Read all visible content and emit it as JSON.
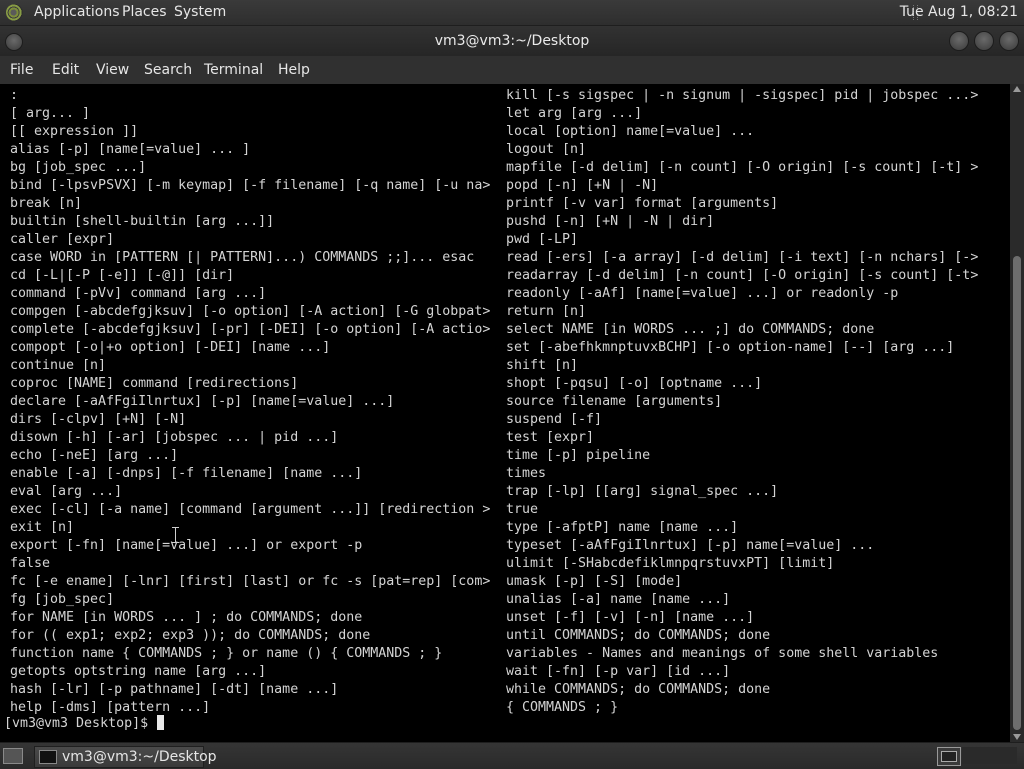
{
  "top_panel": {
    "menus": [
      "Applications",
      "Places",
      "System"
    ],
    "clock": "Tue Aug  1, 08:21"
  },
  "window": {
    "title": "vm3@vm3:~/Desktop",
    "menubar": [
      "File",
      "Edit",
      "View",
      "Search",
      "Terminal",
      "Help"
    ]
  },
  "terminal": {
    "left_column": [
      ":",
      "[ arg... ]",
      "[[ expression ]]",
      "alias [-p] [name[=value] ... ]",
      "bg [job_spec ...]",
      "bind [-lpsvPSVX] [-m keymap] [-f filename] [-q name] [-u na>",
      "break [n]",
      "builtin [shell-builtin [arg ...]]",
      "caller [expr]",
      "case WORD in [PATTERN [| PATTERN]...) COMMANDS ;;]... esac",
      "cd [-L|[-P [-e]] [-@]] [dir]",
      "command [-pVv] command [arg ...]",
      "compgen [-abcdefgjksuv] [-o option] [-A action] [-G globpat>",
      "complete [-abcdefgjksuv] [-pr] [-DEI] [-o option] [-A actio>",
      "compopt [-o|+o option] [-DEI] [name ...]",
      "continue [n]",
      "coproc [NAME] command [redirections]",
      "declare [-aAfFgiIlnrtux] [-p] [name[=value] ...]",
      "dirs [-clpv] [+N] [-N]",
      "disown [-h] [-ar] [jobspec ... | pid ...]",
      "echo [-neE] [arg ...]",
      "enable [-a] [-dnps] [-f filename] [name ...]",
      "eval [arg ...]",
      "exec [-cl] [-a name] [command [argument ...]] [redirection >",
      "exit [n]",
      "export [-fn] [name[=value] ...] or export -p",
      "false",
      "fc [-e ename] [-lnr] [first] [last] or fc -s [pat=rep] [com>",
      "fg [job_spec]",
      "for NAME [in WORDS ... ] ; do COMMANDS; done",
      "for (( exp1; exp2; exp3 )); do COMMANDS; done",
      "function name { COMMANDS ; } or name () { COMMANDS ; }",
      "getopts optstring name [arg ...]",
      "hash [-lr] [-p pathname] [-dt] [name ...]",
      "help [-dms] [pattern ...]"
    ],
    "right_column": [
      "kill [-s sigspec | -n signum | -sigspec] pid | jobspec ...>",
      "let arg [arg ...]",
      "local [option] name[=value] ...",
      "logout [n]",
      "mapfile [-d delim] [-n count] [-O origin] [-s count] [-t] >",
      "popd [-n] [+N | -N]",
      "printf [-v var] format [arguments]",
      "pushd [-n] [+N | -N | dir]",
      "pwd [-LP]",
      "read [-ers] [-a array] [-d delim] [-i text] [-n nchars] [->",
      "readarray [-d delim] [-n count] [-O origin] [-s count] [-t>",
      "readonly [-aAf] [name[=value] ...] or readonly -p",
      "return [n]",
      "select NAME [in WORDS ... ;] do COMMANDS; done",
      "set [-abefhkmnptuvxBCHP] [-o option-name] [--] [arg ...]",
      "shift [n]",
      "shopt [-pqsu] [-o] [optname ...]",
      "source filename [arguments]",
      "suspend [-f]",
      "test [expr]",
      "time [-p] pipeline",
      "times",
      "trap [-lp] [[arg] signal_spec ...]",
      "true",
      "type [-afptP] name [name ...]",
      "typeset [-aAfFgiIlnrtux] [-p] name[=value] ...",
      "ulimit [-SHabcdefiklmnpqrstuvxPT] [limit]",
      "umask [-p] [-S] [mode]",
      "unalias [-a] name [name ...]",
      "unset [-f] [-v] [-n] [name ...]",
      "until COMMANDS; do COMMANDS; done",
      "variables - Names and meanings of some shell variables",
      "wait [-fn] [-p var] [id ...]",
      "while COMMANDS; do COMMANDS; done",
      "{ COMMANDS ; }"
    ],
    "prompt": "[vm3@vm3 Desktop]$ "
  },
  "taskbar": {
    "task_label": "vm3@vm3:~/Desktop"
  }
}
